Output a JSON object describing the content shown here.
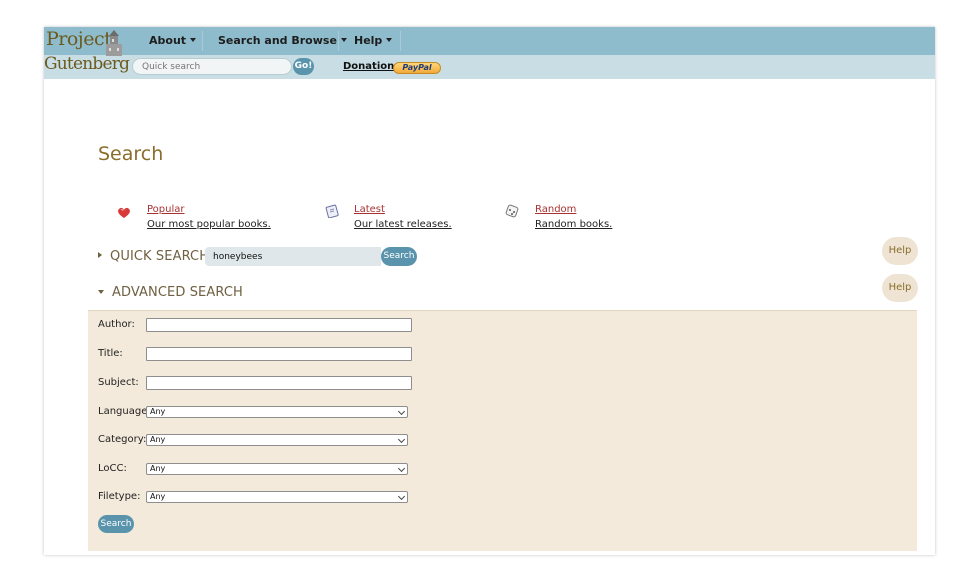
{
  "logo": {
    "line1": "Project",
    "line2": "Gutenberg"
  },
  "nav": [
    {
      "label": "About"
    },
    {
      "label": "Search and Browse"
    },
    {
      "label": "Help"
    }
  ],
  "header_search": {
    "placeholder": "Quick search",
    "button": "Go!"
  },
  "donation": {
    "label": "Donation",
    "paypal": "PayPal"
  },
  "page_title": "Search",
  "features": [
    {
      "link": "Popular",
      "desc": "Our most popular books.",
      "icon": "heart-icon"
    },
    {
      "link": "Latest",
      "desc": "Our latest releases.",
      "icon": "book-icon"
    },
    {
      "link": "Random",
      "desc": "Random books.",
      "icon": "dice-icon"
    }
  ],
  "quick_search": {
    "heading": "QUICK SEARCH",
    "value": "honeybees",
    "button": "Search",
    "help": "Help"
  },
  "advanced_search": {
    "heading": "ADVANCED SEARCH",
    "help": "Help",
    "fields": {
      "author": "Author:",
      "title": "Title:",
      "subject": "Subject:"
    },
    "selects": [
      {
        "label": "Language:",
        "value": "Any"
      },
      {
        "label": "Category:",
        "value": "Any"
      },
      {
        "label": "LoCC:",
        "value": "Any"
      },
      {
        "label": "Filetype:",
        "value": "Any"
      }
    ],
    "button": "Search"
  },
  "colors": {
    "topbar": "#8ebccc",
    "subbar": "#c8dde4",
    "panel": "#f3eadb",
    "button": "#5a94ac",
    "title": "#8a6d2a",
    "link": "#a83232"
  }
}
